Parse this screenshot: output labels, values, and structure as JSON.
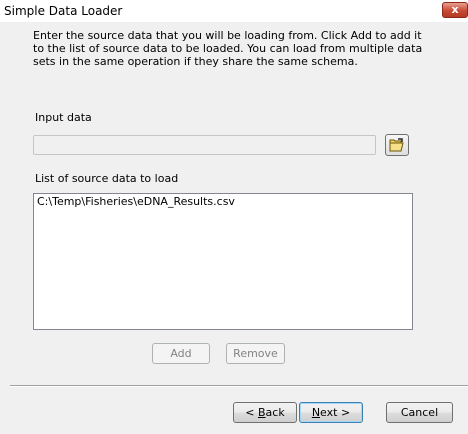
{
  "window": {
    "title": "Simple Data Loader",
    "close_glyph": "x"
  },
  "instructions": "Enter the source data that you will be loading from. Click Add to add it to the list of source data to be loaded. You can load from multiple data sets in the same operation if they share the same schema.",
  "input": {
    "label": "Input data",
    "value": "",
    "browse_icon": "open-folder-icon"
  },
  "source_list": {
    "label": "List of source data to load",
    "items": [
      "C:\\Temp\\Fisheries\\eDNA_Results.csv"
    ]
  },
  "list_buttons": {
    "add_label": "Add",
    "remove_label": "Remove"
  },
  "footer": {
    "back_mnemonic": "B",
    "back_rest": "ack",
    "back_prefix": "< ",
    "next_mnemonic": "N",
    "next_rest": "ext >",
    "cancel_label": "Cancel"
  },
  "colors": {
    "close_button": "#c74a34",
    "dialog_background": "#f0f0f0",
    "default_button_border": "#3c7fb1"
  }
}
